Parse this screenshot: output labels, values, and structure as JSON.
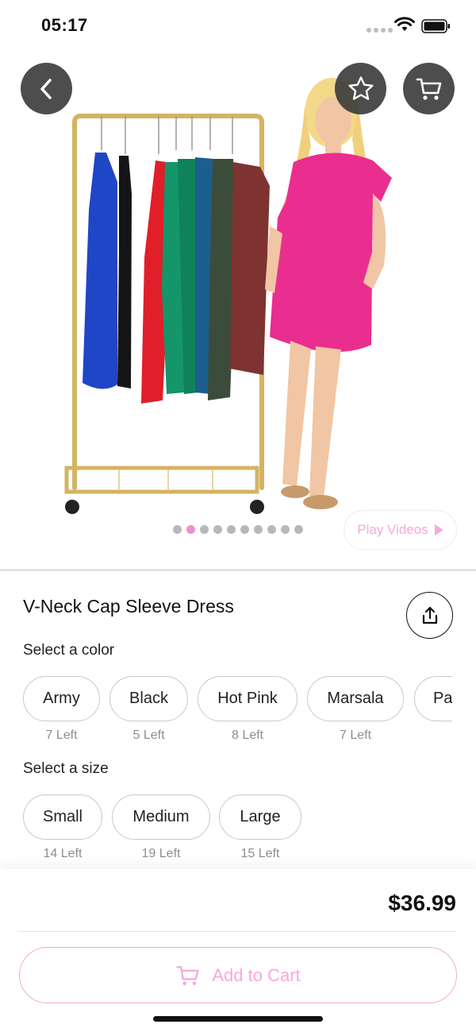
{
  "status_bar": {
    "time": "05:17"
  },
  "product": {
    "title": "V-Neck Cap Sleeve Dress",
    "price": "$36.99",
    "image_pages": 10,
    "active_image_page": 2
  },
  "media": {
    "play_videos_label": "Play Videos"
  },
  "color_section": {
    "label": "Select a color",
    "options": [
      {
        "name": "Army",
        "stock": "7 Left"
      },
      {
        "name": "Black",
        "stock": "5 Left"
      },
      {
        "name": "Hot Pink",
        "stock": "8 Left"
      },
      {
        "name": "Marsala",
        "stock": "7 Left"
      },
      {
        "name": "Pa",
        "stock": ""
      }
    ]
  },
  "size_section": {
    "label": "Select a size",
    "options": [
      {
        "name": "Small",
        "stock": "14 Left"
      },
      {
        "name": "Medium",
        "stock": "19 Left"
      },
      {
        "name": "Large",
        "stock": "15 Left"
      }
    ]
  },
  "cart": {
    "add_label": "Add to Cart"
  },
  "colors": {
    "accent_pink": "#f7a8dc",
    "active_dot": "#f08fd0",
    "dark_button": "#3a3a3a"
  },
  "icons": {
    "back": "chevron-left-icon",
    "favorite": "star-outline-icon",
    "cart": "cart-icon",
    "share": "share-icon",
    "play": "play-icon"
  }
}
